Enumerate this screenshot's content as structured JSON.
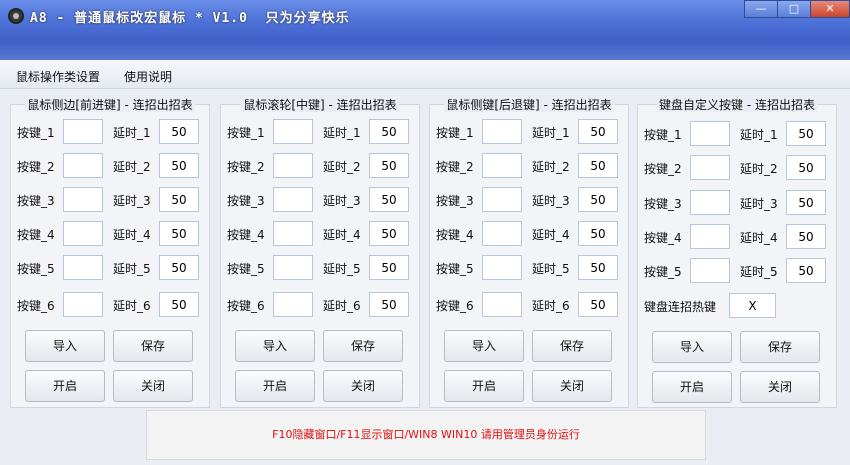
{
  "window": {
    "title": "A8 - 普通鼠标改宏鼠标 * V1.0  只为分享快乐",
    "minimize": "—",
    "maximize": "□",
    "close": "✕"
  },
  "menu": [
    {
      "label": "鼠标操作类设置"
    },
    {
      "label": "使用说明"
    }
  ],
  "panels": [
    {
      "title": "鼠标侧边[前进键] - 连招出招表",
      "rows": [
        {
          "key_label": "按键_1",
          "key_value": "",
          "delay_label": "延时_1",
          "delay_value": "50"
        },
        {
          "key_label": "按键_2",
          "key_value": "",
          "delay_label": "延时_2",
          "delay_value": "50"
        },
        {
          "key_label": "按键_3",
          "key_value": "",
          "delay_label": "延时_3",
          "delay_value": "50"
        },
        {
          "key_label": "按键_4",
          "key_value": "",
          "delay_label": "延时_4",
          "delay_value": "50"
        },
        {
          "key_label": "按键_5",
          "key_value": "",
          "delay_label": "延时_5",
          "delay_value": "50"
        },
        {
          "key_label": "按键_6",
          "key_value": "",
          "delay_label": "延时_6",
          "delay_value": "50"
        }
      ],
      "buttons": [
        "导入",
        "保存",
        "开启",
        "关闭"
      ]
    },
    {
      "title": "鼠标滚轮[中键] - 连招出招表",
      "rows": [
        {
          "key_label": "按键_1",
          "key_value": "",
          "delay_label": "延时_1",
          "delay_value": "50"
        },
        {
          "key_label": "按键_2",
          "key_value": "",
          "delay_label": "延时_2",
          "delay_value": "50"
        },
        {
          "key_label": "按键_3",
          "key_value": "",
          "delay_label": "延时_3",
          "delay_value": "50"
        },
        {
          "key_label": "按键_4",
          "key_value": "",
          "delay_label": "延时_4",
          "delay_value": "50"
        },
        {
          "key_label": "按键_5",
          "key_value": "",
          "delay_label": "延时_5",
          "delay_value": "50"
        },
        {
          "key_label": "按键_6",
          "key_value": "",
          "delay_label": "延时_6",
          "delay_value": "50"
        }
      ],
      "buttons": [
        "导入",
        "保存",
        "开启",
        "关闭"
      ]
    },
    {
      "title": "鼠标侧键[后退键] - 连招出招表",
      "rows": [
        {
          "key_label": "按键_1",
          "key_value": "",
          "delay_label": "延时_1",
          "delay_value": "50"
        },
        {
          "key_label": "按键_2",
          "key_value": "",
          "delay_label": "延时_2",
          "delay_value": "50"
        },
        {
          "key_label": "按键_3",
          "key_value": "",
          "delay_label": "延时_3",
          "delay_value": "50"
        },
        {
          "key_label": "按键_4",
          "key_value": "",
          "delay_label": "延时_4",
          "delay_value": "50"
        },
        {
          "key_label": "按键_5",
          "key_value": "",
          "delay_label": "延时_5",
          "delay_value": "50"
        },
        {
          "key_label": "按键_6",
          "key_value": "",
          "delay_label": "延时_6",
          "delay_value": "50"
        }
      ],
      "buttons": [
        "导入",
        "保存",
        "开启",
        "关闭"
      ]
    },
    {
      "title": "键盘自定义按键 - 连招出招表",
      "rows": [
        {
          "key_label": "按键_1",
          "key_value": "",
          "delay_label": "延时_1",
          "delay_value": "50"
        },
        {
          "key_label": "按键_2",
          "key_value": "",
          "delay_label": "延时_2",
          "delay_value": "50"
        },
        {
          "key_label": "按键_3",
          "key_value": "",
          "delay_label": "延时_3",
          "delay_value": "50"
        },
        {
          "key_label": "按键_4",
          "key_value": "",
          "delay_label": "延时_4",
          "delay_value": "50"
        },
        {
          "key_label": "按键_5",
          "key_value": "",
          "delay_label": "延时_5",
          "delay_value": "50"
        }
      ],
      "hotkey_label": "键盘连招热键",
      "hotkey_value": "X",
      "buttons": [
        "导入",
        "保存",
        "开启",
        "关闭"
      ]
    }
  ],
  "status": "F10隐藏窗口/F11显示窗口/WIN8 WIN10 请用管理员身份运行",
  "colors": {
    "titlebar": "#4e72d8",
    "status_text": "#e01010",
    "input_border": "#b6c7da"
  }
}
